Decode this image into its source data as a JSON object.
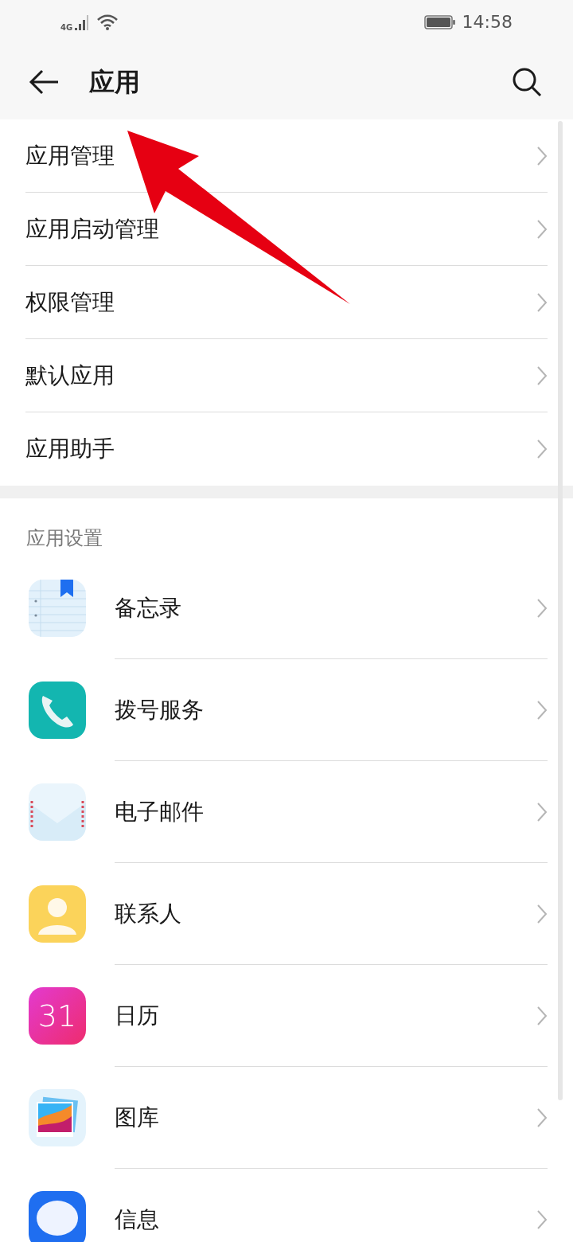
{
  "status_bar": {
    "network": "4G",
    "time": "14:58"
  },
  "header": {
    "title": "应用"
  },
  "menu": [
    {
      "label": "应用管理"
    },
    {
      "label": "应用启动管理"
    },
    {
      "label": "权限管理"
    },
    {
      "label": "默认应用"
    },
    {
      "label": "应用助手"
    }
  ],
  "section": {
    "title": "应用设置"
  },
  "apps": [
    {
      "kind": "notes",
      "label": "备忘录"
    },
    {
      "kind": "phone",
      "label": "拨号服务"
    },
    {
      "kind": "mail",
      "label": "电子邮件"
    },
    {
      "kind": "contacts",
      "label": "联系人"
    },
    {
      "kind": "calendar",
      "label": "日历",
      "icon_text": "31"
    },
    {
      "kind": "gallery",
      "label": "图库"
    },
    {
      "kind": "messages",
      "label": "信息"
    }
  ]
}
